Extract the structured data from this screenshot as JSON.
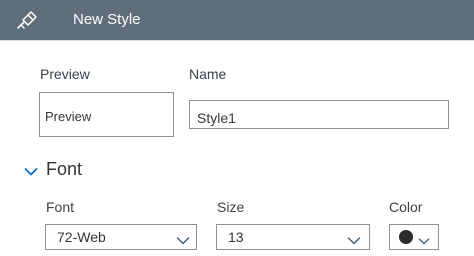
{
  "header": {
    "title": "New Style",
    "icon": "paint-brush-icon",
    "background": "#5e6f7b"
  },
  "preview": {
    "label": "Preview",
    "sample_text": "Preview"
  },
  "name": {
    "label": "Name",
    "value": "Style1"
  },
  "font_section": {
    "title": "Font",
    "expanded": true,
    "font": {
      "label": "Font",
      "value": "72-Web"
    },
    "size": {
      "label": "Size",
      "value": "13"
    },
    "color": {
      "label": "Color",
      "value": "#2c2c2c"
    }
  }
}
